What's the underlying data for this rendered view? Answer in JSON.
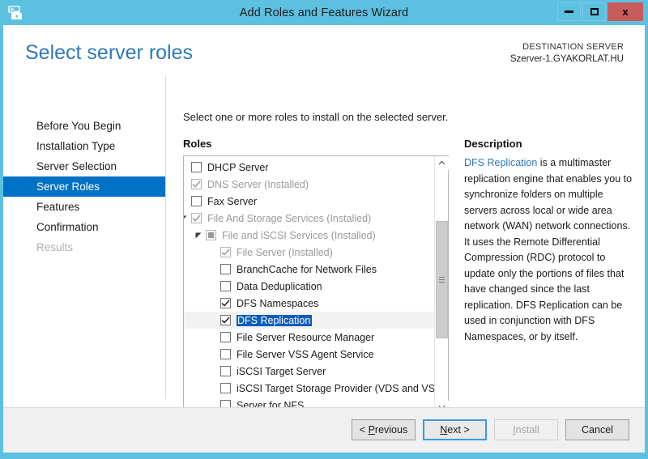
{
  "window": {
    "title": "Add Roles and Features Wizard",
    "icon": "wizard-server-icon",
    "minimize": "–",
    "maximize": "□",
    "close": "x"
  },
  "header": {
    "page_title": "Select server roles",
    "destination_label": "DESTINATION SERVER",
    "destination_server": "Szerver-1.GYAKORLAT.HU"
  },
  "sidebar": {
    "items": [
      {
        "label": "Before You Begin",
        "state": "normal"
      },
      {
        "label": "Installation Type",
        "state": "normal"
      },
      {
        "label": "Server Selection",
        "state": "normal"
      },
      {
        "label": "Server Roles",
        "state": "selected"
      },
      {
        "label": "Features",
        "state": "normal"
      },
      {
        "label": "Confirmation",
        "state": "normal"
      },
      {
        "label": "Results",
        "state": "disabled"
      }
    ]
  },
  "main": {
    "instruction": "Select one or more roles to install on the selected server.",
    "roles_label": "Roles",
    "description_label": "Description",
    "roles": [
      {
        "label": "DHCP Server",
        "indent": 1,
        "checkbox": "unchecked",
        "installed": false,
        "expander": "none",
        "selected": false
      },
      {
        "label": "DNS Server (Installed)",
        "indent": 1,
        "checkbox": "checked-disabled",
        "installed": true,
        "expander": "none",
        "selected": false
      },
      {
        "label": "Fax Server",
        "indent": 1,
        "checkbox": "unchecked",
        "installed": false,
        "expander": "none",
        "selected": false
      },
      {
        "label": "File And Storage Services (Installed)",
        "indent": 1,
        "checkbox": "checked-disabled",
        "installed": true,
        "expander": "expanded",
        "selected": false
      },
      {
        "label": "File and iSCSI Services (Installed)",
        "indent": 2,
        "checkbox": "partial-disabled",
        "installed": true,
        "expander": "expanded",
        "selected": false
      },
      {
        "label": "File Server (Installed)",
        "indent": 3,
        "checkbox": "checked-disabled",
        "installed": true,
        "expander": "none",
        "selected": false
      },
      {
        "label": "BranchCache for Network Files",
        "indent": 3,
        "checkbox": "unchecked",
        "installed": false,
        "expander": "none",
        "selected": false
      },
      {
        "label": "Data Deduplication",
        "indent": 3,
        "checkbox": "unchecked",
        "installed": false,
        "expander": "none",
        "selected": false
      },
      {
        "label": "DFS Namespaces",
        "indent": 3,
        "checkbox": "checked",
        "installed": false,
        "expander": "none",
        "selected": false
      },
      {
        "label": "DFS Replication",
        "indent": 3,
        "checkbox": "checked",
        "installed": false,
        "expander": "none",
        "selected": true
      },
      {
        "label": "File Server Resource Manager",
        "indent": 3,
        "checkbox": "unchecked",
        "installed": false,
        "expander": "none",
        "selected": false
      },
      {
        "label": "File Server VSS Agent Service",
        "indent": 3,
        "checkbox": "unchecked",
        "installed": false,
        "expander": "none",
        "selected": false
      },
      {
        "label": "iSCSI Target Server",
        "indent": 3,
        "checkbox": "unchecked",
        "installed": false,
        "expander": "none",
        "selected": false
      },
      {
        "label": "iSCSI Target Storage Provider (VDS and VSS",
        "indent": 3,
        "checkbox": "unchecked",
        "installed": false,
        "expander": "none",
        "selected": false
      },
      {
        "label": "Server for NFS",
        "indent": 3,
        "checkbox": "unchecked",
        "installed": false,
        "expander": "none",
        "selected": false
      }
    ],
    "description": {
      "accent_term": "DFS Replication",
      "body": " is a multimaster replication engine that enables you to synchronize folders on multiple servers across local or wide area network (WAN) network connections. It uses the Remote Differential Compression (RDC) protocol to update only the portions of files that have changed since the last replication. DFS Replication can be used in conjunction with DFS Namespaces, or by itself."
    }
  },
  "footer": {
    "previous": "< Previous",
    "next": "Next >",
    "install": "Install",
    "cancel": "Cancel"
  }
}
